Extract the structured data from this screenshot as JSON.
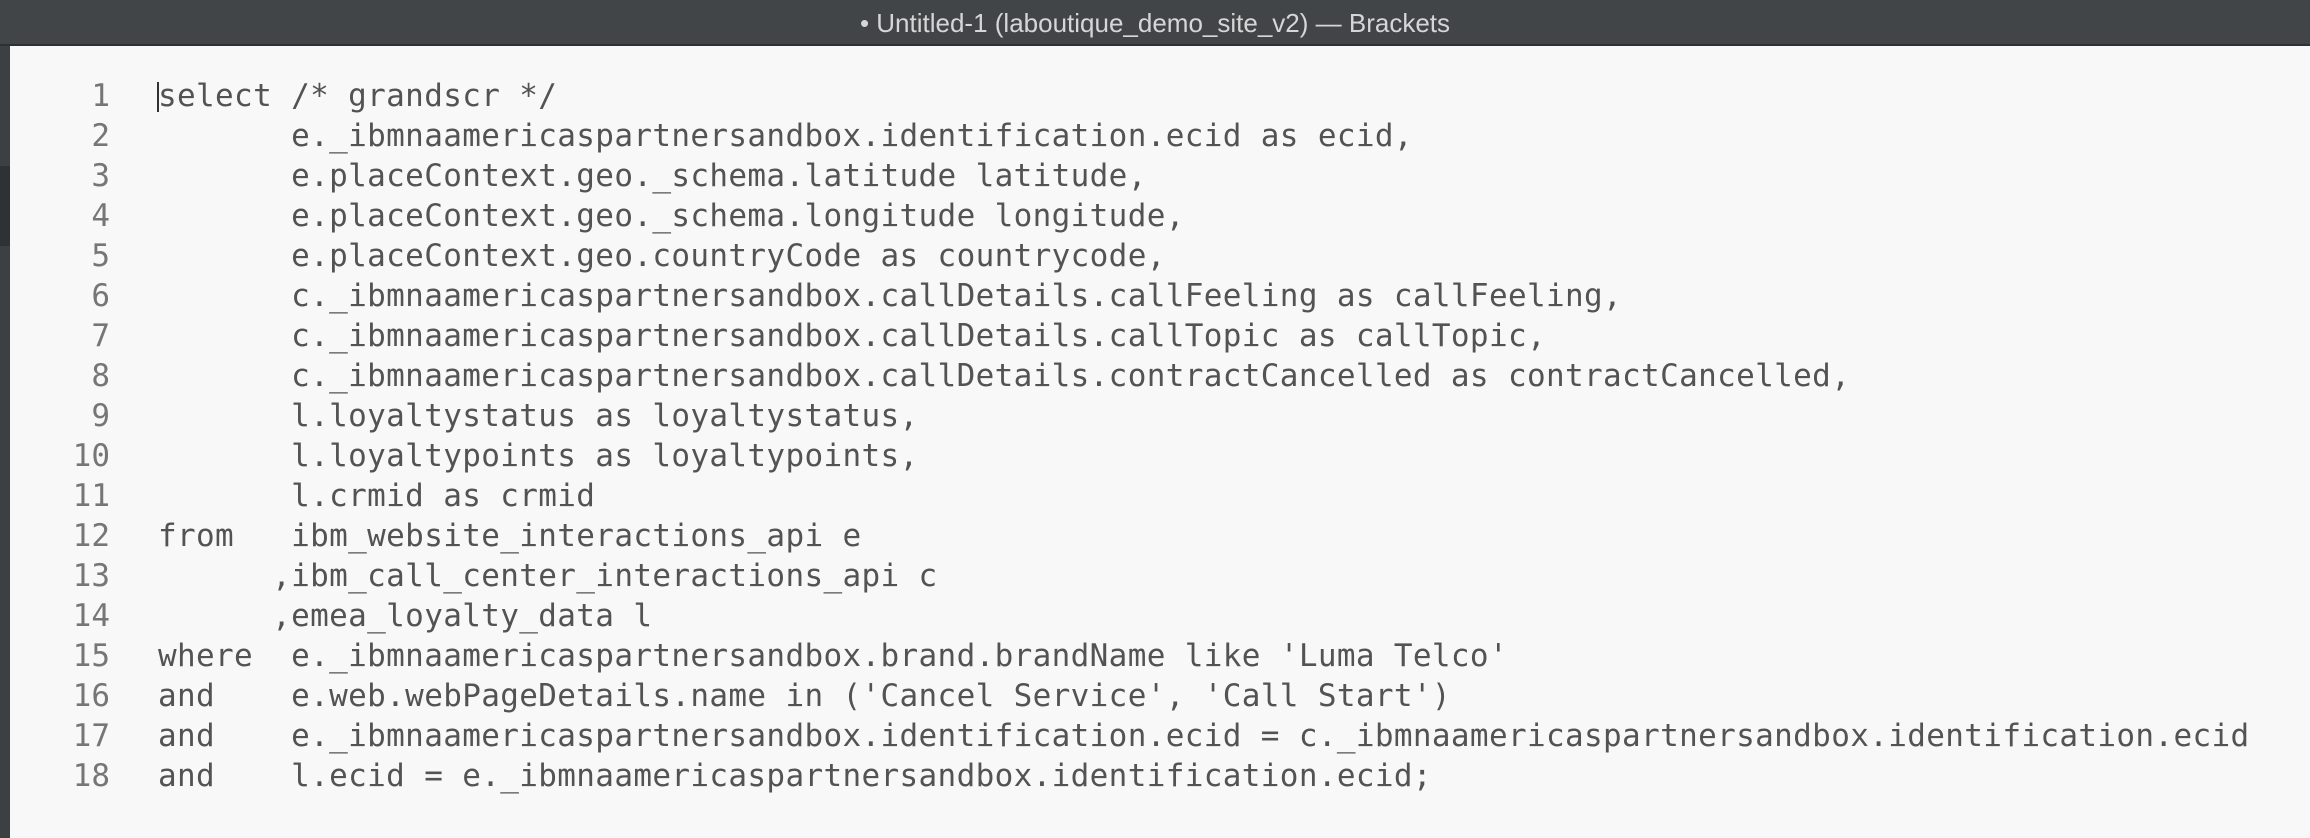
{
  "window": {
    "title": "• Untitled-1 (laboutique_demo_site_v2) — Brackets"
  },
  "editor": {
    "lines": [
      {
        "num": "1",
        "text": "select /* grandscr */"
      },
      {
        "num": "2",
        "text": "       e._ibmnaamericaspartnersandbox.identification.ecid as ecid,"
      },
      {
        "num": "3",
        "text": "       e.placeContext.geo._schema.latitude latitude,"
      },
      {
        "num": "4",
        "text": "       e.placeContext.geo._schema.longitude longitude,"
      },
      {
        "num": "5",
        "text": "       e.placeContext.geo.countryCode as countrycode,"
      },
      {
        "num": "6",
        "text": "       c._ibmnaamericaspartnersandbox.callDetails.callFeeling as callFeeling,"
      },
      {
        "num": "7",
        "text": "       c._ibmnaamericaspartnersandbox.callDetails.callTopic as callTopic,"
      },
      {
        "num": "8",
        "text": "       c._ibmnaamericaspartnersandbox.callDetails.contractCancelled as contractCancelled,"
      },
      {
        "num": "9",
        "text": "       l.loyaltystatus as loyaltystatus,"
      },
      {
        "num": "10",
        "text": "       l.loyaltypoints as loyaltypoints,"
      },
      {
        "num": "11",
        "text": "       l.crmid as crmid"
      },
      {
        "num": "12",
        "text": "from   ibm_website_interactions_api e"
      },
      {
        "num": "13",
        "text": "      ,ibm_call_center_interactions_api c"
      },
      {
        "num": "14",
        "text": "      ,emea_loyalty_data l"
      },
      {
        "num": "15",
        "text": "where  e._ibmnaamericaspartnersandbox.brand.brandName like 'Luma Telco'"
      },
      {
        "num": "16",
        "text": "and    e.web.webPageDetails.name in ('Cancel Service', 'Call Start')"
      },
      {
        "num": "17",
        "text": "and    e._ibmnaamericaspartnersandbox.identification.ecid = c._ibmnaamericaspartnersandbox.identification.ecid"
      },
      {
        "num": "18",
        "text": "and    l.ecid = e._ibmnaamericaspartnersandbox.identification.ecid;"
      }
    ]
  },
  "colors": {
    "titlebar_bg": "#424548",
    "editor_bg": "#f8f8f8",
    "code_text": "#535353",
    "line_number": "#767676"
  }
}
